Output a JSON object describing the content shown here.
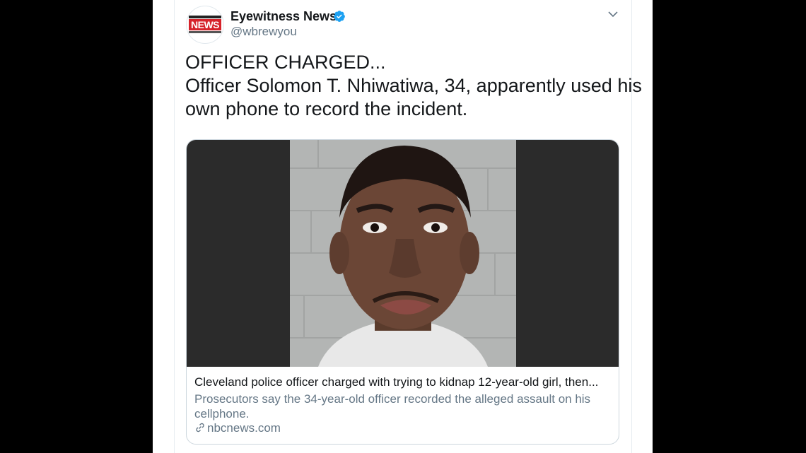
{
  "tweet": {
    "author_name": "Eyewitness News",
    "author_handle": "@wbrewyou",
    "avatar_logo_text": "NEWS",
    "text_line1": "OFFICER CHARGED...",
    "text_line2": "Officer Solomon T. Nhiwatiwa, 34, apparently used his",
    "text_line3": "own phone to record the incident."
  },
  "card": {
    "title": "Cleveland police officer charged with trying to kidnap 12-year-old girl, then...",
    "description": "Prosecutors say the 34-year-old officer recorded the alleged assault on his cellphone.",
    "domain": "nbcnews.com"
  },
  "colors": {
    "verified_blue": "#1da1f2",
    "link_gray": "#657786",
    "logo_red": "#d6222a",
    "media_dark": "#2b2b2b"
  },
  "icons": {
    "verified": "verified-badge-icon",
    "menu": "chevron-down-icon",
    "link": "link-icon"
  }
}
